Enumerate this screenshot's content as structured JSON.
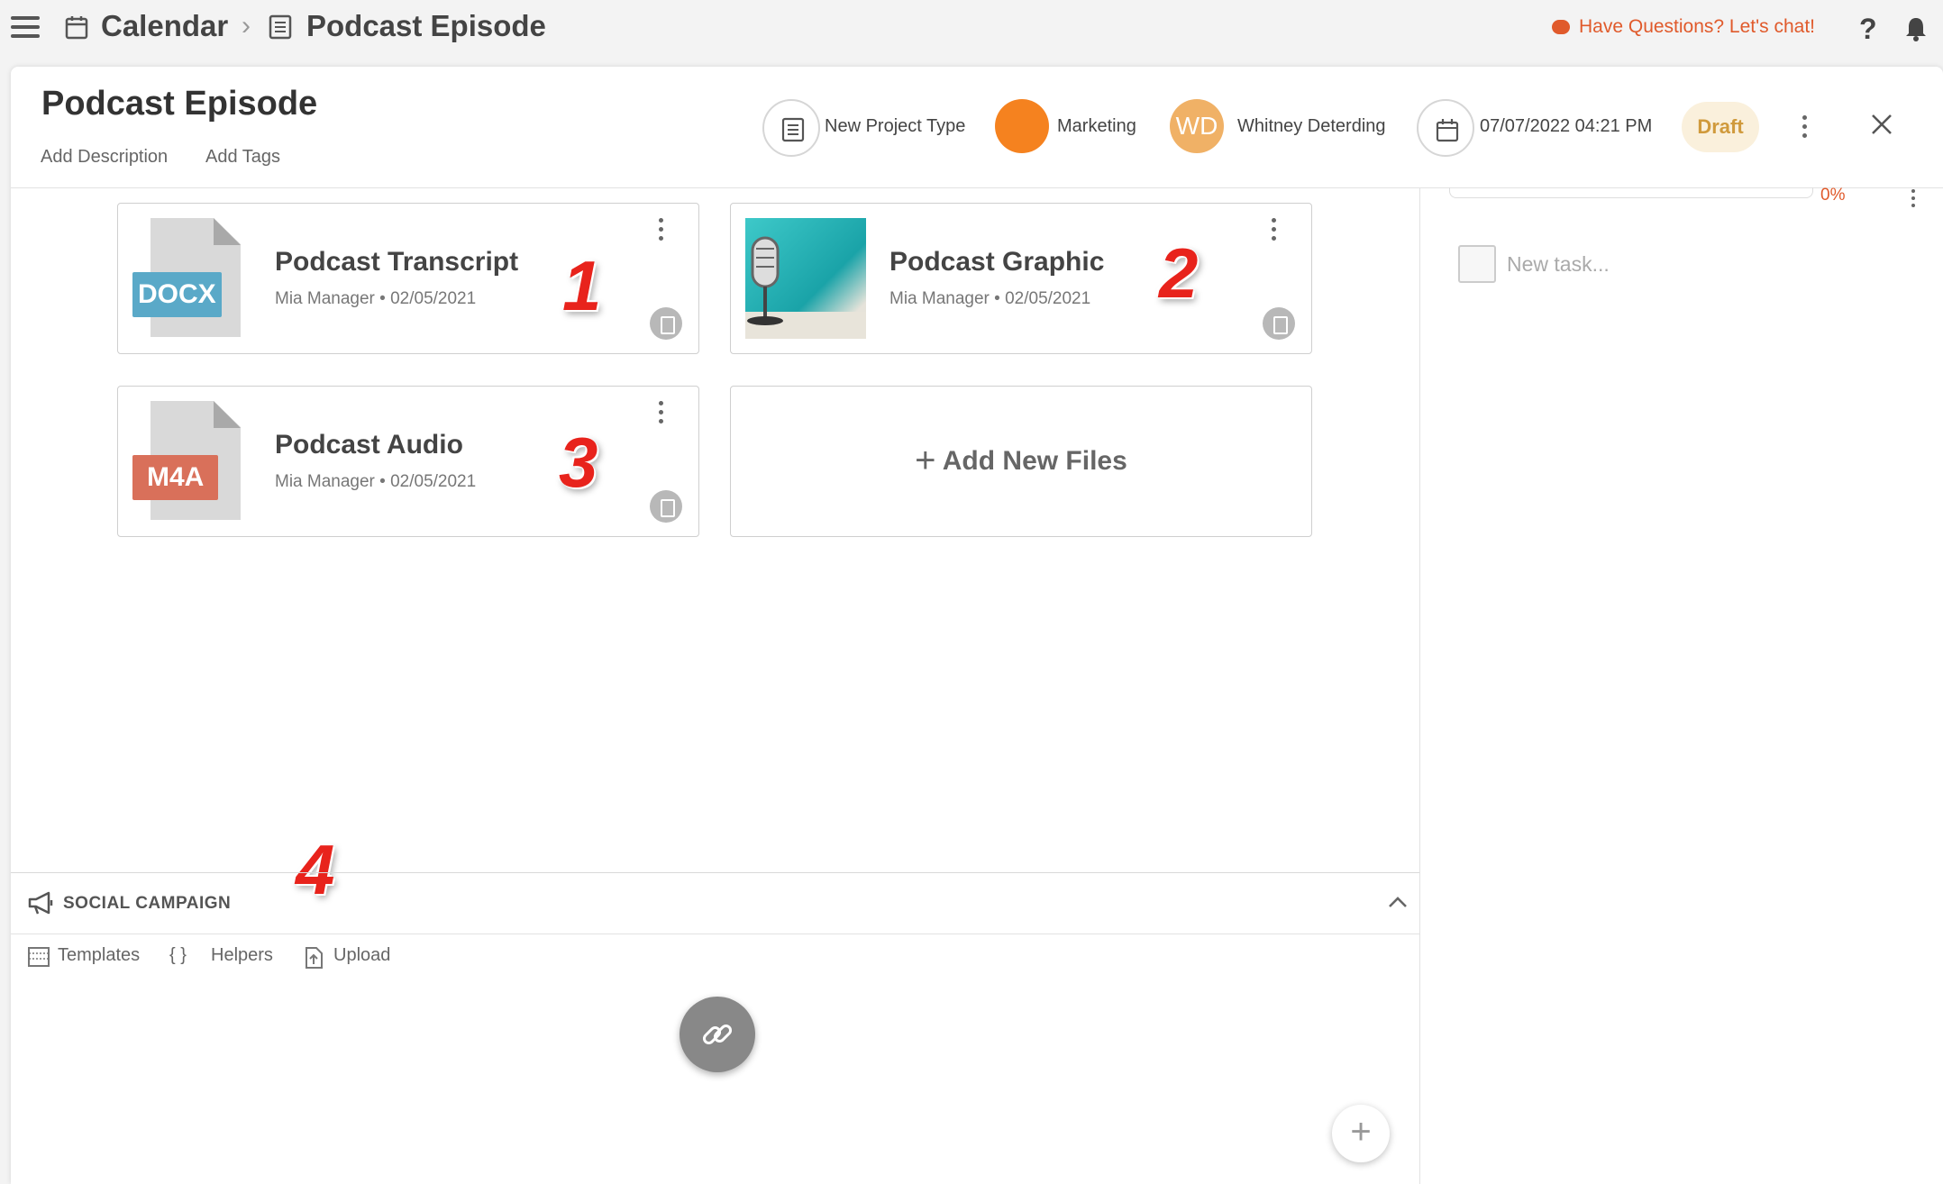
{
  "breadcrumb": {
    "root": "Calendar",
    "current": "Podcast Episode"
  },
  "topbar": {
    "chat_label": "Have Questions? Let's chat!",
    "help": "?"
  },
  "project": {
    "title": "Podcast Episode",
    "add_description": "Add Description",
    "add_tags": "Add Tags",
    "type_label": "New Project Type",
    "team_label": "Marketing",
    "team_color": "#f5821f",
    "owner_initials": "WD",
    "owner_name": "Whitney Deterding",
    "due_date": "07/07/2022 04:21 PM",
    "status": "Draft"
  },
  "files": [
    {
      "name": "Podcast Transcript",
      "meta": "Mia Manager • 02/05/2021",
      "badge": "DOCX",
      "badge_color": "#5aa9c8"
    },
    {
      "name": "Podcast Graphic",
      "meta": "Mia Manager • 02/05/2021",
      "thumbnail": "microphone"
    },
    {
      "name": "Podcast Audio",
      "meta": "Mia Manager • 02/05/2021",
      "badge": "M4A",
      "badge_color": "#d9705a"
    }
  ],
  "add_files_label": "Add New Files",
  "markers": [
    "1",
    "2",
    "3",
    "4"
  ],
  "social": {
    "label": "SOCIAL CAMPAIGN",
    "tools": {
      "templates": "Templates",
      "helpers": "Helpers",
      "upload": "Upload"
    }
  },
  "tasks": {
    "progress": "0%",
    "new_task_placeholder": "New task..."
  }
}
